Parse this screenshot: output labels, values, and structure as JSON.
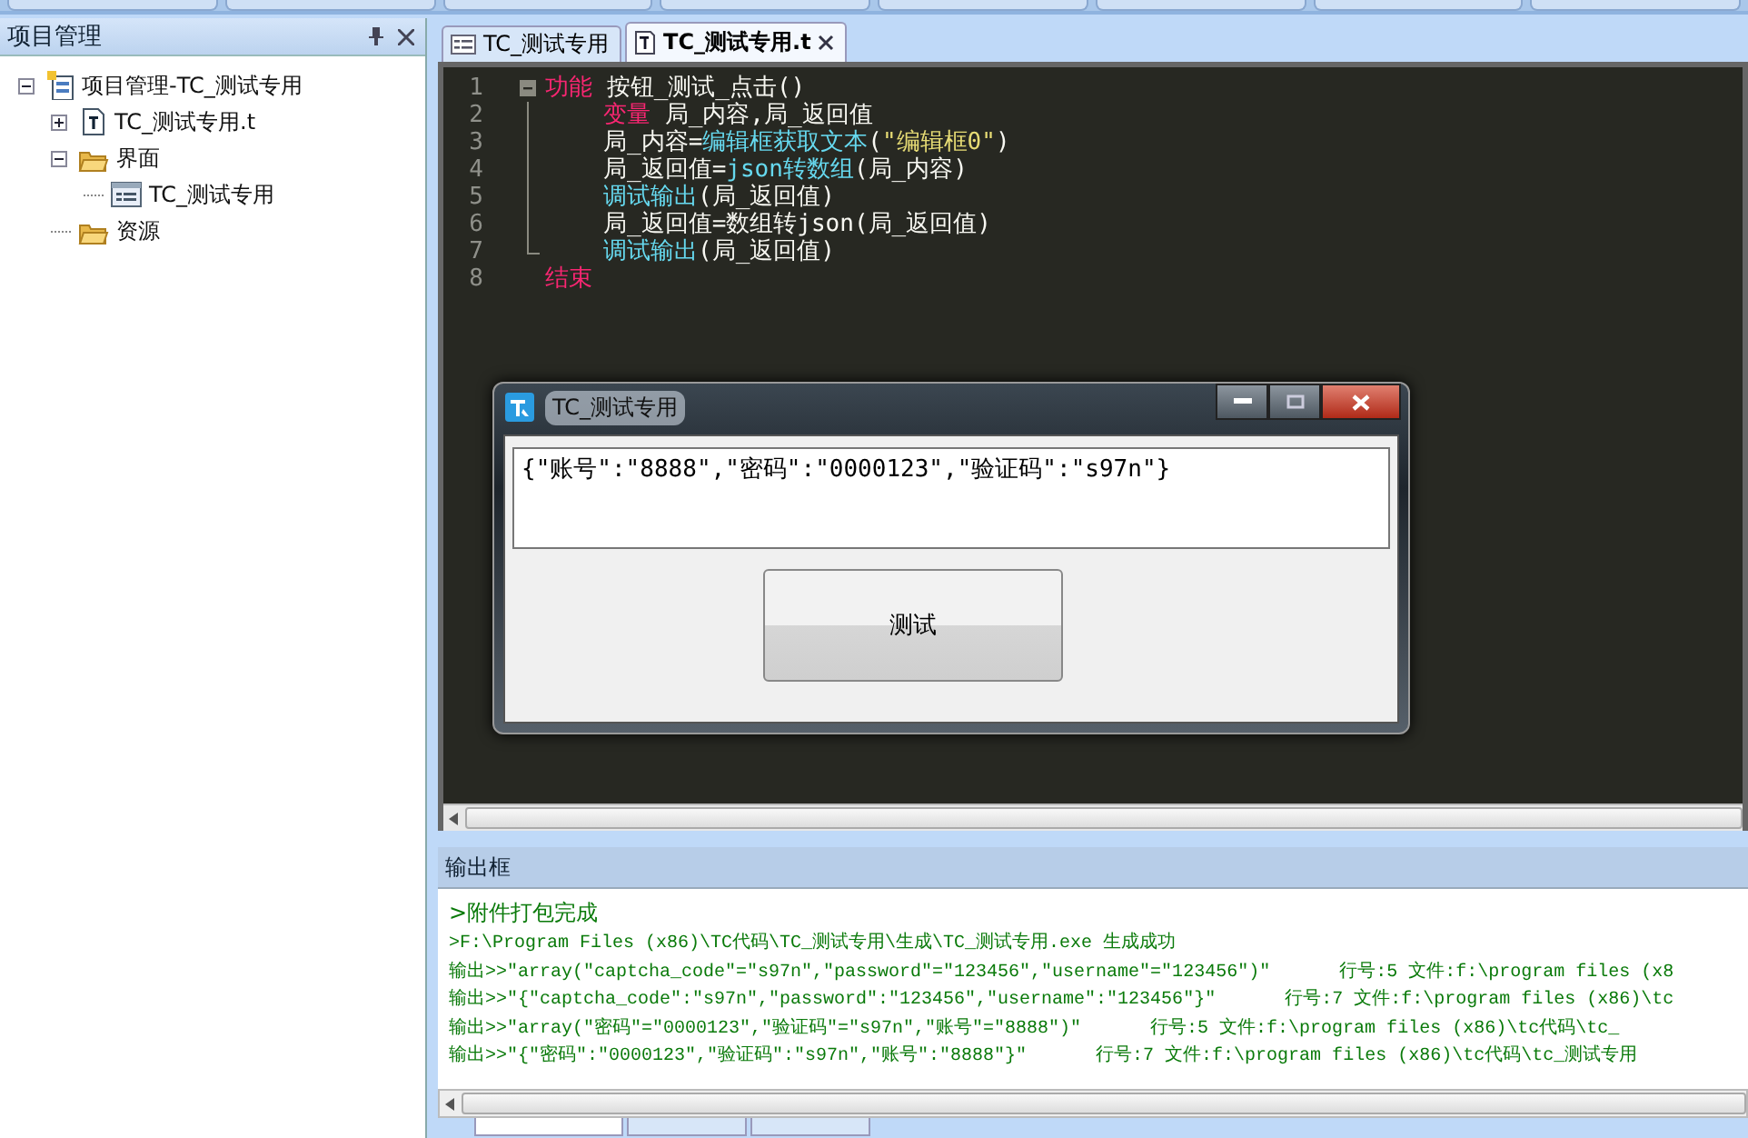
{
  "project_panel": {
    "title": "项目管理",
    "tree": [
      {
        "label": "项目管理-TC_测试专用",
        "kind": "project",
        "expanded": true,
        "children": [
          {
            "label": "TC_测试专用.t",
            "kind": "file",
            "expanded": false
          },
          {
            "label": "界面",
            "kind": "folder",
            "expanded": true,
            "children": [
              {
                "label": "TC_测试专用",
                "kind": "form"
              }
            ]
          },
          {
            "label": "资源",
            "kind": "folder"
          }
        ]
      }
    ]
  },
  "editor_tabs": [
    {
      "label": "TC_测试专用",
      "kind": "form",
      "selected": false
    },
    {
      "label": "TC_测试专用.t",
      "kind": "file",
      "selected": true
    }
  ],
  "code": [
    {
      "number": "1",
      "tokens": [
        {
          "kind": "keyword",
          "text": "功能"
        },
        {
          "kind": "plain",
          "text": " 按钮_测试_点击()"
        }
      ],
      "children": [
        {
          "number": "2",
          "tokens": [
            {
              "kind": "keyword",
              "text": "变量"
            },
            {
              "kind": "plain",
              "text": " 局_内容,局_返回值"
            }
          ]
        },
        {
          "number": "3",
          "tokens": [
            {
              "kind": "plain",
              "text": "局_内容="
            },
            {
              "kind": "function",
              "text": "编辑框获取文本"
            },
            {
              "kind": "plain",
              "text": "("
            },
            {
              "kind": "string",
              "text": "\"编辑框0\""
            },
            {
              "kind": "plain",
              "text": ")"
            }
          ]
        },
        {
          "number": "4",
          "tokens": [
            {
              "kind": "plain",
              "text": "局_返回值="
            },
            {
              "kind": "function",
              "text": "json转数组"
            },
            {
              "kind": "plain",
              "text": "(局_内容)"
            }
          ]
        },
        {
          "number": "5",
          "tokens": [
            {
              "kind": "function",
              "text": "调试输出"
            },
            {
              "kind": "plain",
              "text": "(局_返回值)"
            }
          ]
        },
        {
          "number": "6",
          "tokens": [
            {
              "kind": "plain",
              "text": "局_返回值=数组转json(局_返回值)"
            }
          ]
        },
        {
          "number": "7",
          "tokens": [
            {
              "kind": "function",
              "text": "调试输出"
            },
            {
              "kind": "plain",
              "text": "(局_返回值)"
            }
          ]
        }
      ]
    },
    {
      "number": "8",
      "tokens": [
        {
          "kind": "keyword",
          "text": "结束"
        }
      ]
    }
  ],
  "dialog": {
    "title": "TC_测试专用",
    "text_value": "{\"账号\":\"8888\",\"密码\":\"0000123\",\"验证码\":\"s97n\"}",
    "button": "测试"
  },
  "output_panel": {
    "title": "输出框",
    "lines": [
      {
        "message": ">附件打包完成"
      },
      {
        "message": ">F:\\Program Files (x86)\\TC代码\\TC_测试专用\\生成\\TC_测试专用.exe 生成成功"
      },
      {
        "message": "输出>>\"array(\"captcha_code\"=\"s97n\",\"password\"=\"123456\",\"username\"=\"123456\")\"",
        "location": "行号:5 文件:f:\\program files (x8"
      },
      {
        "message": "输出>>\"{\"captcha_code\":\"s97n\",\"password\":\"123456\",\"username\":\"123456\"}\"",
        "location": "行号:7 文件:f:\\program files (x86)\\tc"
      },
      {
        "message": "输出>>\"array(\"密码\"=\"0000123\",\"验证码\"=\"s97n\",\"账号\"=\"8888\")\"",
        "location": "行号:5 文件:f:\\program files (x86)\\tc代码\\tc_"
      },
      {
        "message": "输出>>\"{\"密码\":\"0000123\",\"验证码\":\"s97n\",\"账号\":\"8888\"}\"",
        "location": "行号:7 文件:f:\\program files (x86)\\tc代码\\tc_测试专用"
      }
    ]
  },
  "bottom_tabs": [
    {
      "selected": true
    },
    {
      "selected": false
    },
    {
      "selected": false
    }
  ]
}
